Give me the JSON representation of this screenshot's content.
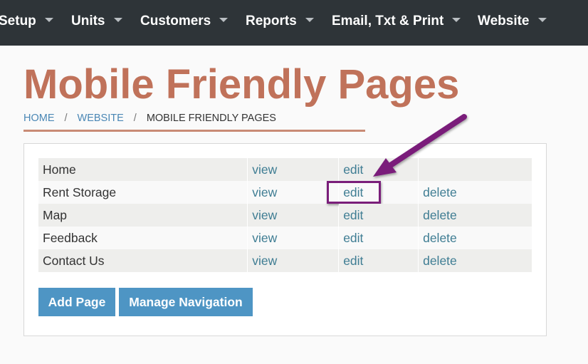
{
  "nav": {
    "items": [
      {
        "label": "Setup"
      },
      {
        "label": "Units"
      },
      {
        "label": "Customers"
      },
      {
        "label": "Reports"
      },
      {
        "label": "Email, Txt & Print"
      },
      {
        "label": "Website"
      }
    ]
  },
  "page": {
    "title": "Mobile Friendly Pages"
  },
  "breadcrumb": {
    "home": "HOME",
    "sep": "/",
    "website": "WEBSITE",
    "current": "MOBILE FRIENDLY PAGES"
  },
  "table": {
    "rows": [
      {
        "name": "Home",
        "view": "view",
        "edit": "edit",
        "delete": ""
      },
      {
        "name": "Rent Storage",
        "view": "view",
        "edit": "edit",
        "delete": "delete"
      },
      {
        "name": "Map",
        "view": "view",
        "edit": "edit",
        "delete": "delete"
      },
      {
        "name": "Feedback",
        "view": "view",
        "edit": "edit",
        "delete": "delete"
      },
      {
        "name": "Contact Us",
        "view": "view",
        "edit": "edit",
        "delete": "delete"
      }
    ]
  },
  "buttons": {
    "add_page": "Add Page",
    "manage_navigation": "Manage Navigation"
  },
  "colors": {
    "nav_bg": "#2e3438",
    "title": "#c0725a",
    "link": "#3f7d93",
    "button": "#4e95c4",
    "annotation": "#7a1e7a"
  }
}
